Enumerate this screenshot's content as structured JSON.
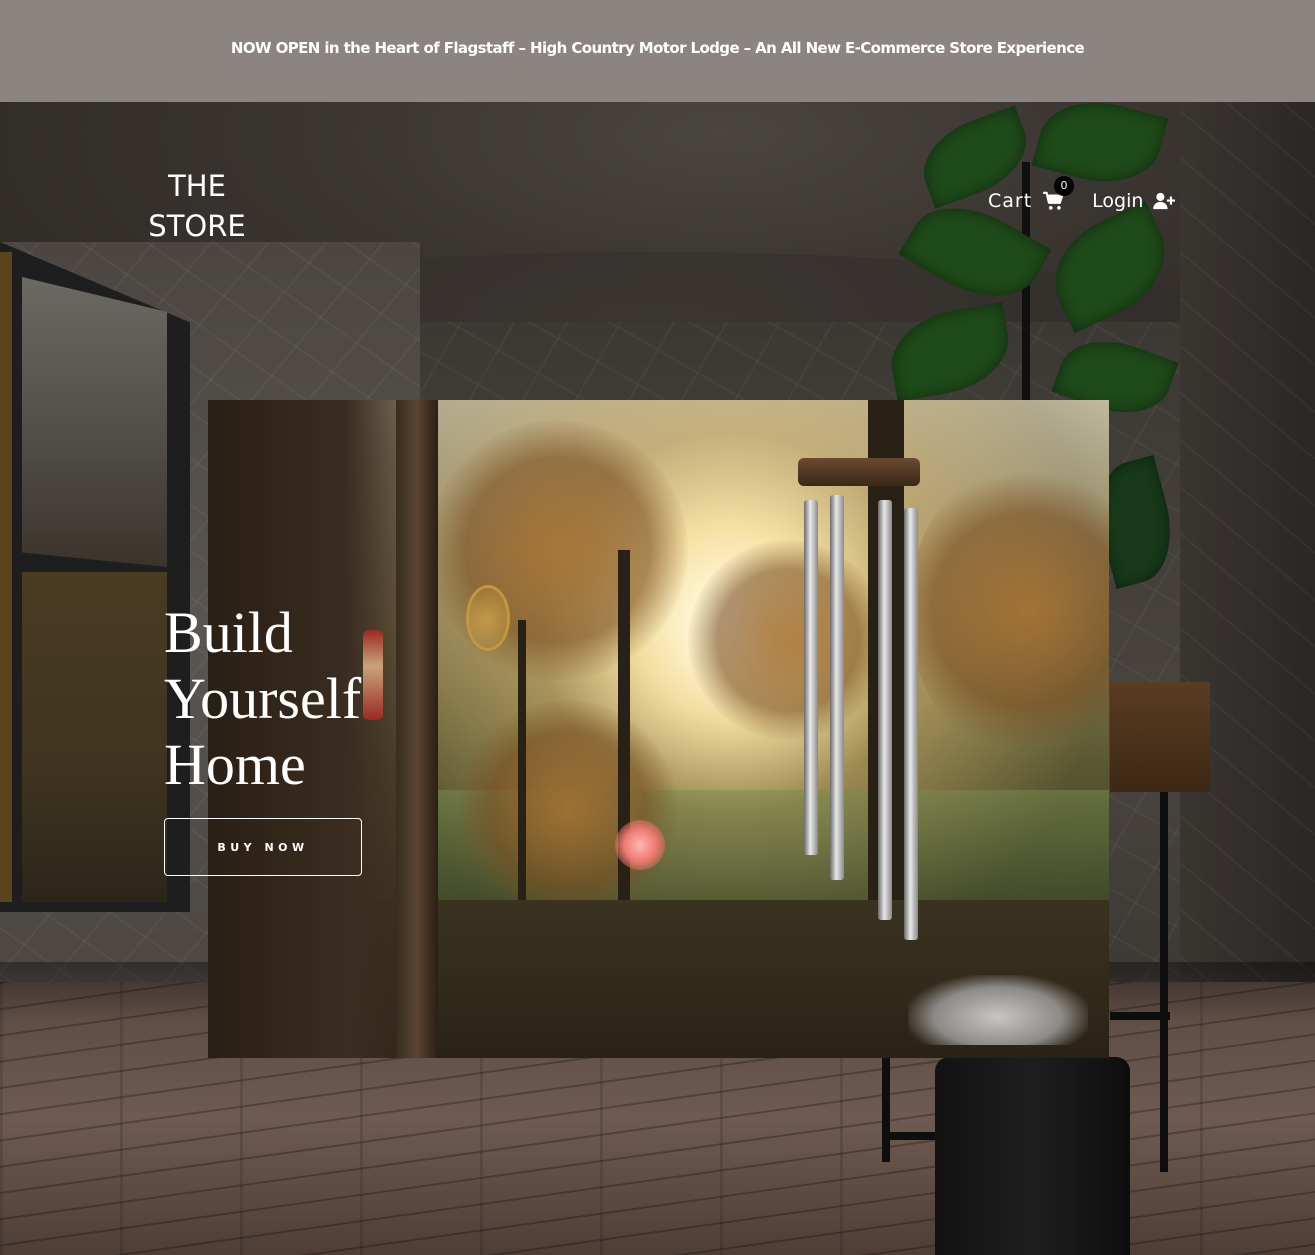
{
  "announcement": {
    "text": "NOW OPEN in the Heart of Flagstaff – High Country Motor Lodge – An All New E-Commerce Store Experience"
  },
  "header": {
    "logo_line1": "THE",
    "logo_line2": "STORE",
    "cart_label": "Cart",
    "cart_count": "0",
    "cart_icon": "shopping-cart-icon",
    "login_label": "Login",
    "login_icon": "user-plus-icon"
  },
  "hero": {
    "headline_line1": "Build",
    "headline_line2": "Yourself",
    "headline_line3": "Home",
    "button_label": "BUY NOW"
  },
  "colors": {
    "announcement_bg": "#8b8480",
    "text": "#ffffff",
    "badge_bg": "#000000"
  }
}
